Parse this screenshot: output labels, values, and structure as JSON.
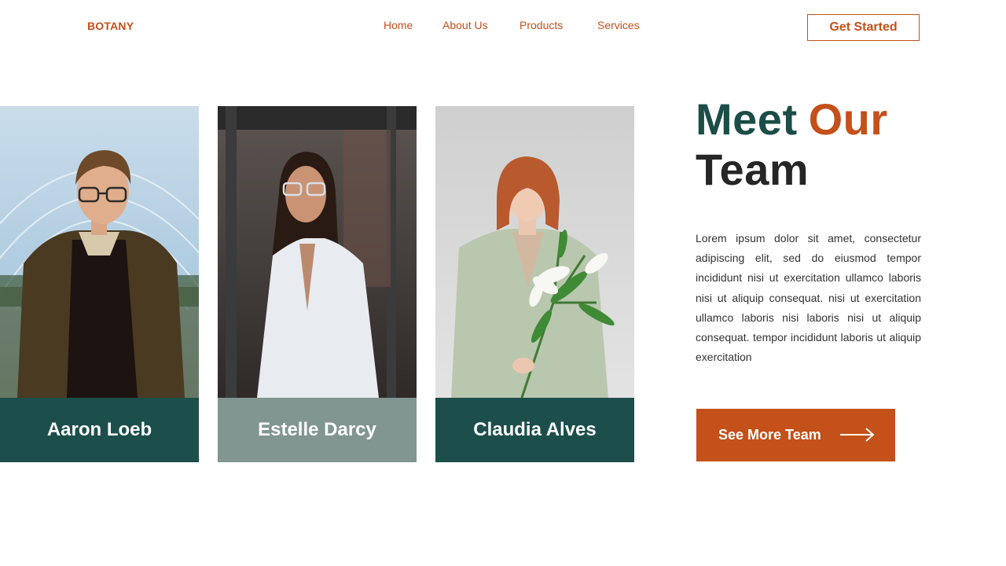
{
  "brand": {
    "logo_text": "BOTANY"
  },
  "nav": {
    "items": [
      {
        "label": "Home"
      },
      {
        "label": "About Us"
      },
      {
        "label": "Products"
      },
      {
        "label": "Services"
      }
    ],
    "cta_label": "Get Started"
  },
  "team": {
    "members": [
      {
        "name": "Aaron Loeb",
        "bar_color": "#1c4f4b"
      },
      {
        "name": "Estelle Darcy",
        "bar_color": "#819591"
      },
      {
        "name": "Claudia Alves",
        "bar_color": "#1c4f4b"
      }
    ]
  },
  "intro": {
    "heading_word1": "Meet",
    "heading_word2": "Our",
    "heading_word3": "Team",
    "description": "Lorem ipsum dolor sit amet, consectetur adipiscing elit, sed do eiusmod tempor incididunt nisi ut exercitation ullamco laboris nisi ut aliquip consequat. nisi ut exercitation ullamco laboris nisi laboris nisi ut aliquip consequat. tempor incididunt laboris ut aliquip exercitation",
    "button_label": "See More Team",
    "button_icon": "arrow-right-icon"
  },
  "colors": {
    "accent": "#c4501a",
    "dark_green": "#1c4f4b",
    "sage": "#819591",
    "heading_dark": "#262626"
  }
}
